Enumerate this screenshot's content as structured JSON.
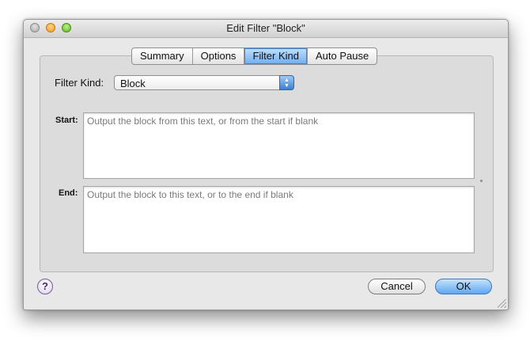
{
  "window": {
    "title": "Edit Filter \"Block\""
  },
  "tabs": [
    {
      "label": "Summary",
      "active": false
    },
    {
      "label": "Options",
      "active": false
    },
    {
      "label": "Filter Kind",
      "active": true
    },
    {
      "label": "Auto Pause",
      "active": false
    }
  ],
  "filter_kind": {
    "label": "Filter Kind:",
    "selected": "Block"
  },
  "start": {
    "label": "Start:",
    "placeholder": "Output the block from this text, or from the start if blank"
  },
  "end": {
    "label": "End:",
    "placeholder": "Output the block to this text, or to the end if blank"
  },
  "buttons": {
    "help_label": "?",
    "cancel_label": "Cancel",
    "ok_label": "OK"
  },
  "icons": {
    "close": "close-icon",
    "minimize": "minimize-icon",
    "zoom": "zoom-icon",
    "select_arrows": "up-down-arrows-icon",
    "resize": "resize-grip-icon",
    "help": "help-icon"
  },
  "colors": {
    "accent": "#5ea7f0",
    "window_bg": "#e8e8e8"
  }
}
